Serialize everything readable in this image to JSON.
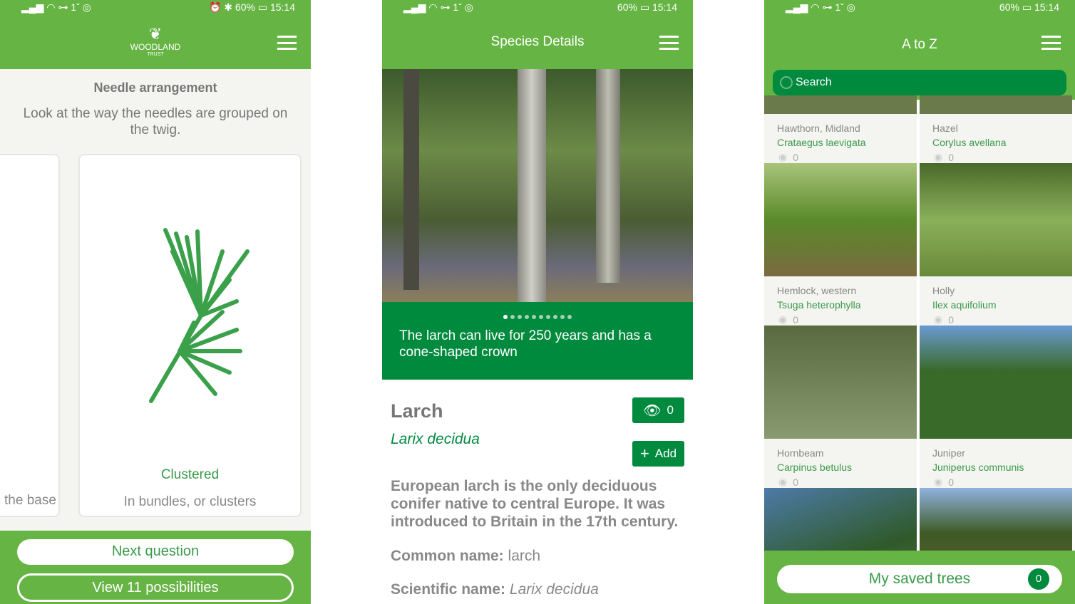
{
  "status": {
    "time": "15:14",
    "battery": "60%"
  },
  "colors": {
    "header": "#66b544",
    "accent": "#008a3e"
  },
  "panel1": {
    "logo_text": "WOODLAND",
    "logo_sub": "TRUST",
    "title": "Needle arrangement",
    "description": "Look at the way the needles are grouped on the twig.",
    "prev_card_label": "the base",
    "card_title": "Clustered",
    "card_desc": "In bundles, or clusters",
    "next_button": "Next question",
    "view_button": "View 11 possibilities"
  },
  "panel2": {
    "header": "Species Details",
    "caption": "The larch can live for 250 years and has a cone-shaped crown",
    "slide_count": 10,
    "active_slide": 1,
    "name": "Larch",
    "latin": "Larix decidua",
    "seen_count": "0",
    "add_label": "Add",
    "summary": "European larch is the only deciduous conifer native to central Europe. It was introduced to Britain in the 17th century.",
    "common_label": "Common name:",
    "common_value": "larch",
    "scientific_label": "Scientific name:",
    "scientific_value": "Larix decidua"
  },
  "panel3": {
    "header": "A to Z",
    "search_placeholder": "Search",
    "tiles": [
      {
        "common": "Hawthorn, Midland",
        "latin": "Crataegus laevigata",
        "count": "0"
      },
      {
        "common": "Hazel",
        "latin": "Corylus avellana",
        "count": "0"
      },
      {
        "common": "Hemlock, western",
        "latin": "Tsuga heterophylla",
        "count": "0"
      },
      {
        "common": "Holly",
        "latin": "Ilex aquifolium",
        "count": "0"
      },
      {
        "common": "Hornbeam",
        "latin": "Carpinus betulus",
        "count": "0"
      },
      {
        "common": "Juniper",
        "latin": "Juniperus communis",
        "count": "0"
      }
    ],
    "saved_label": "My saved trees",
    "saved_count": "0"
  }
}
